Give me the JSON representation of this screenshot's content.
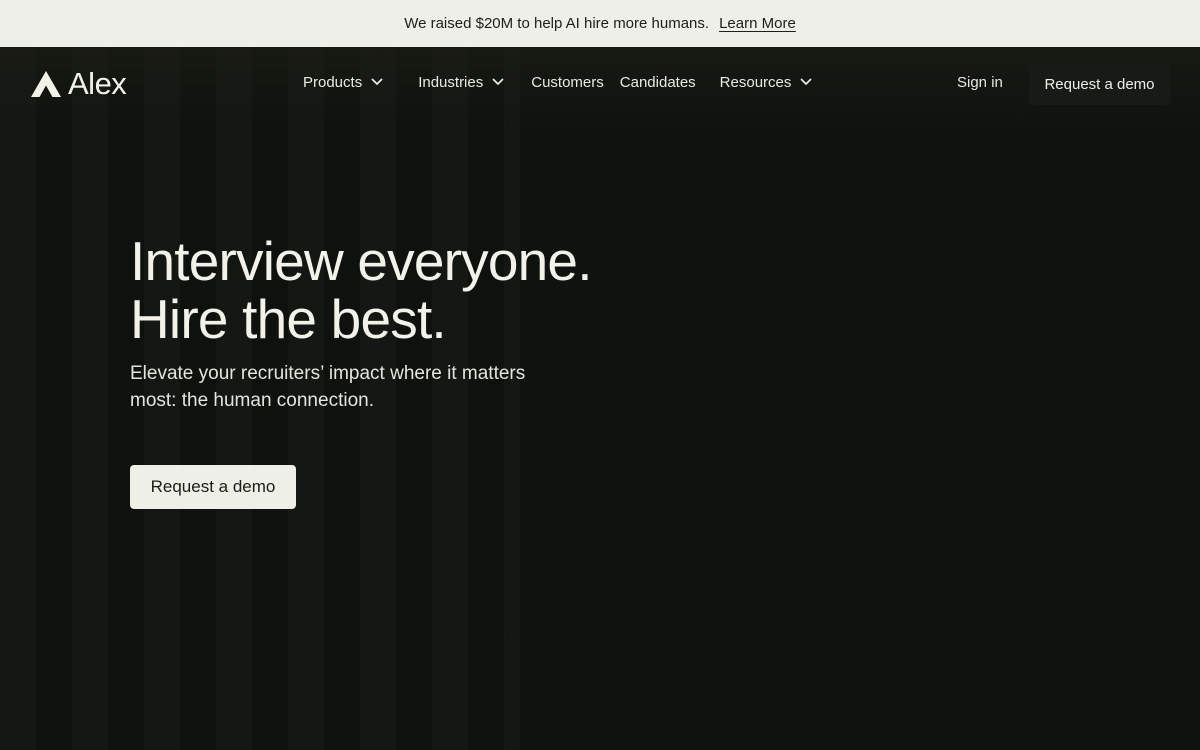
{
  "announcement": {
    "text": "We raised $20M to help AI hire more humans.",
    "link_label": "Learn More"
  },
  "brand": {
    "name": "Alex",
    "logo_icon": "triangle-logo-icon"
  },
  "nav": {
    "items": [
      {
        "label": "Products",
        "has_dropdown": true
      },
      {
        "label": "Industries",
        "has_dropdown": true
      },
      {
        "label": "Customers",
        "has_dropdown": false
      },
      {
        "label": "Candidates",
        "has_dropdown": false
      },
      {
        "label": "Resources",
        "has_dropdown": true
      }
    ],
    "dropdown_icon": "chevron-down-icon",
    "sign_in_label": "Sign in",
    "cta_label": "Request a demo"
  },
  "hero": {
    "title_line1": "Interview everyone.",
    "title_line2": "Hire the best.",
    "subtitle": "Elevate your recruiters’ impact where it matters most: the human connection.",
    "cta_label": "Request a demo"
  },
  "colors": {
    "background": "#0f120e",
    "announcement_bg": "#eeefe8",
    "text_light": "#f2f2ea",
    "button_light": "#eeefe6"
  }
}
